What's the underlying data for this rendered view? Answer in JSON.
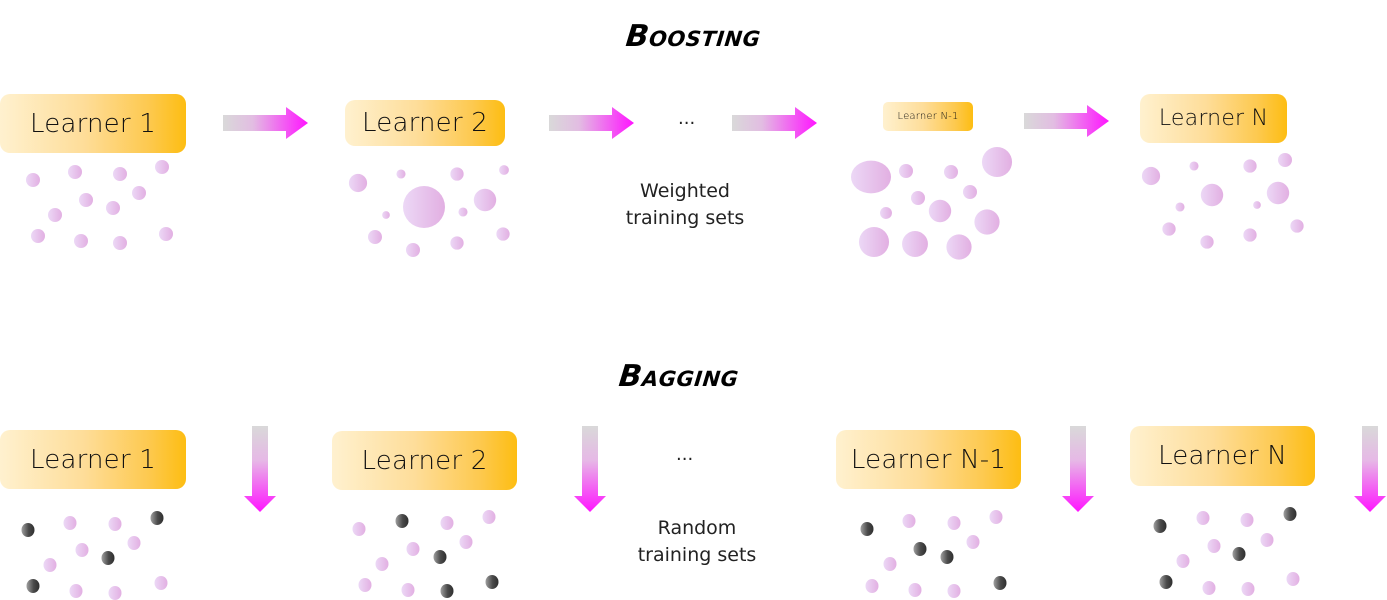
{
  "boosting": {
    "title": "Boosting",
    "learners": [
      {
        "label": "Learner 1"
      },
      {
        "label": "Learner 2"
      },
      {
        "label": "Learner N-1"
      },
      {
        "label": "Learner N"
      }
    ],
    "ellipsis": "...",
    "caption_line1": "Weighted",
    "caption_line2": "training sets",
    "sample_clusters": [
      {
        "learner": "Learner 1",
        "samples": [
          {
            "w": 1
          },
          {
            "w": 1
          },
          {
            "w": 1
          },
          {
            "w": 1
          },
          {
            "w": 1
          },
          {
            "w": 1
          },
          {
            "w": 1
          },
          {
            "w": 1
          },
          {
            "w": 1
          },
          {
            "w": 1
          },
          {
            "w": 1
          },
          {
            "w": 1
          }
        ]
      },
      {
        "learner": "Learner 2",
        "samples": [
          {
            "w": 1.3
          },
          {
            "w": 0.65
          },
          {
            "w": 0.95
          },
          {
            "w": 0.7
          },
          {
            "w": 3
          },
          {
            "w": 1.6
          },
          {
            "w": 0.55
          },
          {
            "w": 0.65
          },
          {
            "w": 1
          },
          {
            "w": 1
          },
          {
            "w": 0.95
          },
          {
            "w": 0.95
          }
        ]
      },
      {
        "learner": "Learner N-1",
        "samples": [
          {
            "w": 2.6
          },
          {
            "w": 1
          },
          {
            "w": 1
          },
          {
            "w": 2.15
          },
          {
            "w": 1
          },
          {
            "w": 1.6
          },
          {
            "w": 1
          },
          {
            "w": 0.85
          },
          {
            "w": 1.8
          },
          {
            "w": 2.15
          },
          {
            "w": 1.85
          },
          {
            "w": 1.8
          }
        ]
      },
      {
        "learner": "Learner N",
        "samples": [
          {
            "w": 1.3
          },
          {
            "w": 0.65
          },
          {
            "w": 0.95
          },
          {
            "w": 1
          },
          {
            "w": 1.6
          },
          {
            "w": 1.6
          },
          {
            "w": 0.65
          },
          {
            "w": 0.55
          },
          {
            "w": 0.95
          },
          {
            "w": 0.95
          },
          {
            "w": 0.95
          },
          {
            "w": 0.95
          }
        ]
      }
    ]
  },
  "bagging": {
    "title": "Bagging",
    "learners": [
      {
        "label": "Learner 1"
      },
      {
        "label": "Learner 2"
      },
      {
        "label": "Learner N-1"
      },
      {
        "label": "Learner N"
      }
    ],
    "ellipsis": "...",
    "caption_line1": "Random",
    "caption_line2": "training sets",
    "sample_clusters": [
      {
        "learner": "Learner 1",
        "selected": [
          true,
          false,
          false,
          true,
          false,
          false,
          true,
          false,
          true,
          false,
          false,
          false
        ]
      },
      {
        "learner": "Learner 2",
        "selected": [
          false,
          true,
          false,
          false,
          false,
          false,
          true,
          false,
          false,
          false,
          true,
          true
        ]
      },
      {
        "learner": "Learner N-1",
        "selected": [
          true,
          false,
          false,
          false,
          true,
          true,
          false,
          false,
          false,
          false,
          false,
          true
        ]
      },
      {
        "learner": "Learner N",
        "selected": [
          true,
          false,
          false,
          true,
          false,
          false,
          true,
          false,
          true,
          false,
          false,
          false
        ]
      }
    ]
  },
  "colors": {
    "sample_light": "#ead5f5",
    "sample_dark": "#e2b0e2",
    "selected_light": "#9a9a9a",
    "selected_dark": "#3a3a3a",
    "arrow_start": "#d9d9d9",
    "arrow_end": "#ff1aff",
    "learner_start": "#fff1cf",
    "learner_end": "#fdbd12"
  }
}
